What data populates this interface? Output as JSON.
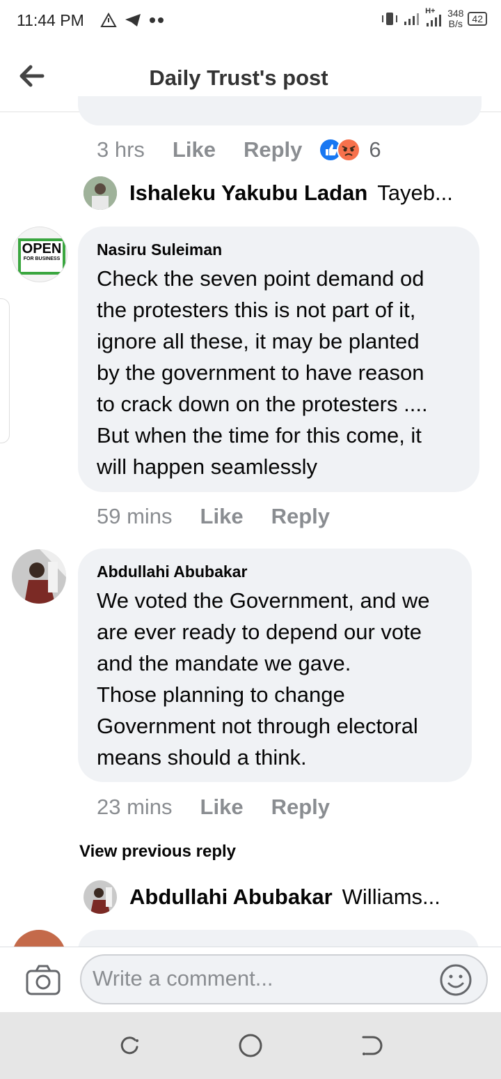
{
  "status_bar": {
    "time": "11:44 PM",
    "icons": [
      "alert-icon",
      "telegram-icon",
      "dots-icon",
      "vibrate-icon",
      "signal-icon",
      "signal-icon"
    ],
    "network_type": "H+",
    "speed_value": "348",
    "speed_unit": "B/s",
    "battery": "42"
  },
  "header": {
    "title": "Daily Trust's post",
    "back_icon": "arrow-left-icon"
  },
  "comments": [
    {
      "time": "3 hrs",
      "like_label": "Like",
      "reply_label": "Reply",
      "reactions": [
        "like",
        "angry"
      ],
      "reaction_count": "6",
      "reply_preview": {
        "name": "Ishaleku Yakubu Ladan",
        "snippet": "Tayeb..."
      }
    },
    {
      "author": "Nasiru Suleiman",
      "avatar_text_1": "OPEN",
      "avatar_text_2": "FOR BUSINESS",
      "lines": [
        "Check the seven point demand od",
        "the protesters this is not part of it,",
        "ignore all these, it may be planted",
        "by the government to have reason",
        "to crack down on the protesters ....",
        "But when the time for this come, it",
        "will happen seamlessly"
      ],
      "time": "59 mins",
      "like_label": "Like",
      "reply_label": "Reply"
    },
    {
      "author": "Abdullahi Abubakar",
      "lines": [
        "We voted the Government, and we",
        "are ever ready to depend our vote",
        "and the mandate we gave.",
        "Those planning to change",
        "Government not through electoral",
        "means should a think."
      ],
      "time": "23 mins",
      "like_label": "Like",
      "reply_label": "Reply",
      "view_previous": "View previous reply",
      "reply_preview": {
        "name": "Abdullahi Abubakar",
        "snippet": "Williams..."
      }
    }
  ],
  "composer": {
    "placeholder": "Write a comment...",
    "camera_icon": "camera-icon",
    "emoji_icon": "smiley-icon"
  },
  "nav_bar": {
    "icons": [
      "recent-apps-icon",
      "home-icon",
      "back-icon"
    ]
  },
  "colors": {
    "bubble": "#f0f2f5",
    "meta_text": "#8a8d91",
    "like_blue": "#1877f2",
    "angry_orange": "#f7714c"
  }
}
